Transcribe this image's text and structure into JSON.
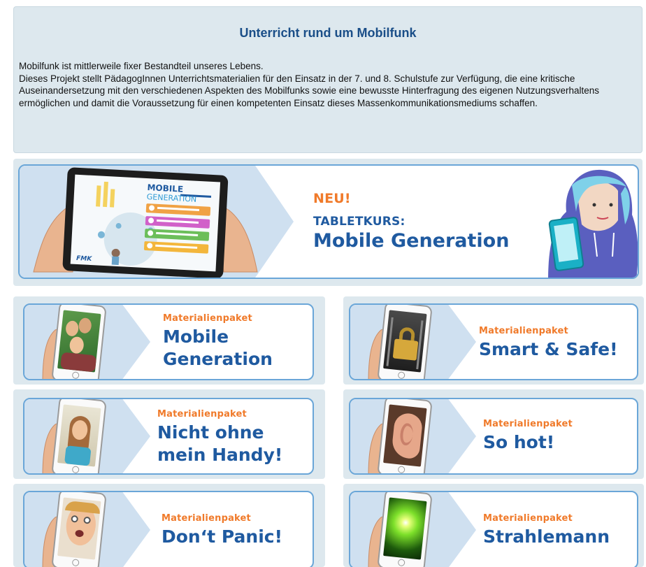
{
  "intro": {
    "title": "Unterricht rund um Mobilfunk",
    "line1": "Mobilfunk ist mittlerweile fixer Bestandteil unseres Lebens.",
    "line2": "Dieses Projekt stellt PädagogInnen Unterrichtsmaterialien für den Einsatz in der 7. und 8. Schulstufe zur Verfügung, die eine kritische Auseinandersetzung mit den verschiedenen Aspekten des Mobilfunks sowie eine bewusste Hinterfragung des eigenen Nutzungsverhaltens ermöglichen und damit die Voraussetzung für einen kompetenten Einsatz dieses Massenkommunikationsmediums schaffen."
  },
  "hero": {
    "new_label": "NEU!",
    "course_label": "TABLETKURS:",
    "course_title": "Mobile Generation",
    "tablet_title_1": "MOBILE",
    "tablet_title_2": "GENERATION",
    "tablet_logo": "FMK"
  },
  "packages": [
    {
      "kicker": "Materialienpaket",
      "title_1": "Mobile",
      "title_2": "Generation",
      "icon": "group-selfie-phone-icon"
    },
    {
      "kicker": "Materialienpaket",
      "title_1": "Smart & Safe!",
      "title_2": "",
      "icon": "padlock-phone-icon"
    },
    {
      "kicker": "Materialienpaket",
      "title_1": "Nicht ohne",
      "title_2": "mein Handy!",
      "icon": "calling-woman-phone-icon"
    },
    {
      "kicker": "Materialienpaket",
      "title_1": "So hot!",
      "title_2": "",
      "icon": "ear-phone-icon"
    },
    {
      "kicker": "Materialienpaket",
      "title_1": "Don‘t Panic!",
      "title_2": "",
      "icon": "shocked-face-phone-icon"
    },
    {
      "kicker": "Materialienpaket",
      "title_1": "Strahlemann",
      "title_2": "",
      "icon": "radiation-burst-phone-icon"
    }
  ],
  "colors": {
    "panel_bg": "#dde8ee",
    "title_blue": "#1a4e88",
    "accent_orange": "#f07a2a",
    "headline_blue": "#1f5aa0",
    "border_blue": "#6aa6d8"
  }
}
